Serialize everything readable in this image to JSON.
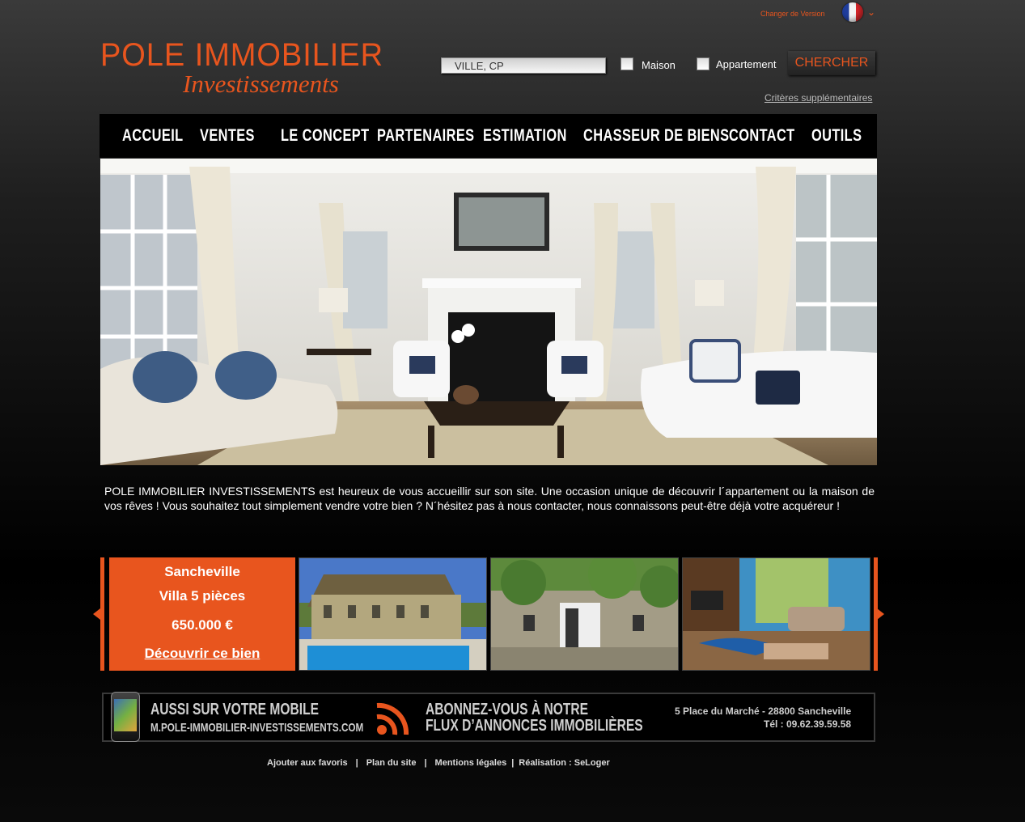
{
  "topbar": {
    "version_label": "Changer de Version",
    "flag_icon": "france-flag-icon"
  },
  "logo": {
    "main": "POLE IMMOBILIER",
    "sub": "Investissements"
  },
  "search": {
    "value": "VILLE, CP",
    "maison_label": "Maison",
    "appartement_label": "Appartement",
    "button_label": "CHERCHER",
    "more_link": "Critères supplémentaires"
  },
  "nav": {
    "items": [
      {
        "label": "ACCUEIL"
      },
      {
        "label": "VENTES"
      },
      {
        "label": "LE CONCEPT"
      },
      {
        "label": "PARTENAIRES"
      },
      {
        "label": "ESTIMATION"
      },
      {
        "label": "CHASSEUR DE BIENS"
      },
      {
        "label": "CONTACT"
      },
      {
        "label": "OUTILS"
      }
    ]
  },
  "intro": {
    "text": "POLE IMMOBILIER INVESTISSEMENTS est heureux de vous accueillir sur son site. Une occasion unique de découvrir l´appartement ou la maison de vos rêves ! Vous souhaitez tout simplement vendre votre bien ? N´hésitez pas à nous contacter, nous connaissons peut-être déjà votre acquéreur !"
  },
  "featured": {
    "city": "Sancheville",
    "type": "Villa 5 pièces",
    "price": "650.000 €",
    "link": "Découvrir ce bien"
  },
  "banner": {
    "mobile_title": "AUSSI SUR VOTRE  MOBILE",
    "mobile_url": "M.POLE-IMMOBILIER-INVESTISSEMENTS.COM",
    "rss_line1": "ABONNEZ-VOUS À NOTRE",
    "rss_line2": "FLUX D’ANNONCES IMMOBILIÈRES",
    "address": "5 Place du Marché - 28800 Sancheville",
    "tel": "Tél : 09.62.39.59.58"
  },
  "footer": {
    "links": [
      "Ajouter aux favoris",
      "Plan du site",
      "Mentions légales",
      "Réalisation : SeLoger"
    ]
  },
  "colors": {
    "accent": "#e8551e"
  }
}
